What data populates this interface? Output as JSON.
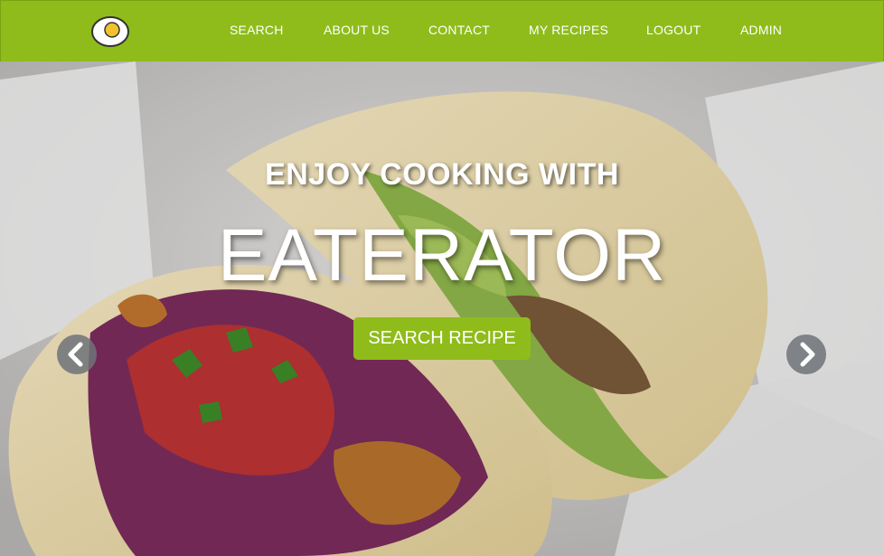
{
  "nav": {
    "logo_icon": "fried-egg-icon",
    "items": [
      {
        "label": "SEARCH"
      },
      {
        "label": "ABOUT US"
      },
      {
        "label": "CONTACT"
      },
      {
        "label": "MY RECIPES"
      },
      {
        "label": "LOGOUT"
      },
      {
        "label": "ADMIN"
      }
    ]
  },
  "hero": {
    "tagline": "ENJOY COOKING WITH",
    "brand": "EATERATOR",
    "cta_label": "SEARCH RECIPE",
    "prev_icon": "chevron-left-icon",
    "next_icon": "chevron-right-icon"
  },
  "colors": {
    "brand_green": "#8fbc1b",
    "text": "#ffffff",
    "arrow_bg": "#6e7378"
  }
}
